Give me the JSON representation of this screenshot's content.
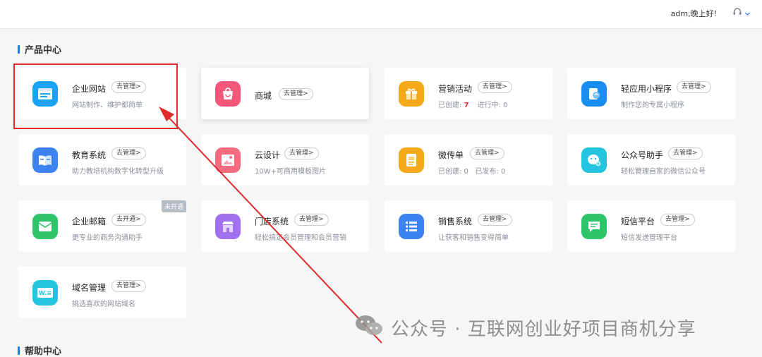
{
  "header": {
    "greeting": "adm,晚上好!",
    "support_icon": "headset-icon"
  },
  "sections": {
    "product_center": "产品中心",
    "help_center": "帮助中心"
  },
  "cards": [
    {
      "name": "企业网站",
      "manage": "去管理>",
      "desc": "网站制作、维护都简单",
      "icon": "website-icon",
      "color": "#1aa3f5"
    },
    {
      "name": "商城",
      "manage": "去管理>",
      "desc": "",
      "icon": "mall-bag-icon",
      "color": "#f5577a"
    },
    {
      "name": "营销活动",
      "manage": "去管理>",
      "desc_created_label": "已创建:",
      "desc_created_value": "7",
      "desc_running": "进行中: 0",
      "icon": "gift-icon",
      "color": "#f7a91c"
    },
    {
      "name": "轻应用小程序",
      "manage": "去管理>",
      "desc": "制作您的专属小程序",
      "icon": "miniprogram-icon",
      "color": "#1a8df0"
    },
    {
      "name": "教育系统",
      "manage": "去管理>",
      "desc": "助力教培机构数字化转型升级",
      "icon": "book-icon",
      "color": "#3c82f0"
    },
    {
      "name": "云设计",
      "manage": "去管理>",
      "desc": "10W+可商用模板图片",
      "icon": "image-icon",
      "color": "#f56c7e"
    },
    {
      "name": "微传单",
      "manage": "去管理>",
      "desc": "已创建: 0   已发布: 0",
      "icon": "flyer-icon",
      "color": "#f7a91c"
    },
    {
      "name": "公众号助手",
      "manage": "去管理>",
      "desc": "轻松管理自家的微信公众号",
      "icon": "wechat-official-icon",
      "color": "#24c3e0"
    },
    {
      "name": "企业邮箱",
      "manage": "去开通>",
      "desc": "更专业的商务沟通助手",
      "icon": "mail-icon",
      "color": "#2dc46a",
      "badge": "未开通"
    },
    {
      "name": "门店系统",
      "manage": "去管理>",
      "desc": "轻松搞定会员管理和会员营销",
      "icon": "store-icon",
      "color": "#a070f0"
    },
    {
      "name": "销售系统",
      "manage": "去管理>",
      "desc": "让获客和销售变得简单",
      "icon": "list-icon",
      "color": "#3c82f0"
    },
    {
      "name": "短信平台",
      "manage": "去管理>",
      "desc": "短信发送管理平台",
      "icon": "sms-icon",
      "color": "#2dc46a"
    },
    {
      "name": "域名管理",
      "manage": "去管理>",
      "desc": "挑选喜欢的网站域名",
      "icon": "domain-icon",
      "color": "#24c3e0",
      "icon_text": "W.≡"
    }
  ],
  "watermark": {
    "text": "公众号 · 互联网创业好项目商机分享",
    "icon": "wechat-logo-icon"
  }
}
